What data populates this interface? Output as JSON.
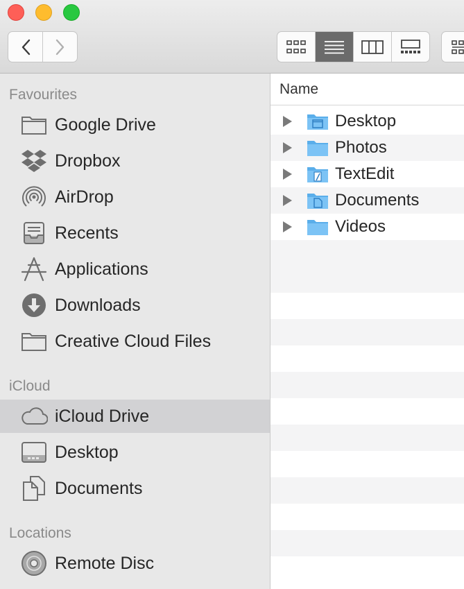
{
  "sidebar": {
    "favourites_title": "Favourites",
    "favourites": [
      {
        "label": "Google Drive",
        "icon": "folder-icon"
      },
      {
        "label": "Dropbox",
        "icon": "dropbox-icon"
      },
      {
        "label": "AirDrop",
        "icon": "airdrop-icon"
      },
      {
        "label": "Recents",
        "icon": "recents-icon"
      },
      {
        "label": "Applications",
        "icon": "applications-icon"
      },
      {
        "label": "Downloads",
        "icon": "downloads-icon"
      },
      {
        "label": "Creative Cloud Files",
        "icon": "folder-icon"
      }
    ],
    "icloud_title": "iCloud",
    "icloud": [
      {
        "label": "iCloud Drive",
        "icon": "icloud-icon",
        "selected": true
      },
      {
        "label": "Desktop",
        "icon": "desktop-icon"
      },
      {
        "label": "Documents",
        "icon": "documents-icon"
      }
    ],
    "locations_title": "Locations",
    "locations": [
      {
        "label": "Remote Disc",
        "icon": "disc-icon"
      }
    ]
  },
  "list": {
    "column_name": "Name",
    "rows": [
      {
        "label": "Desktop",
        "icon": "desktop-folder-icon"
      },
      {
        "label": "Photos",
        "icon": "folder-icon"
      },
      {
        "label": "TextEdit",
        "icon": "textedit-folder-icon"
      },
      {
        "label": "Documents",
        "icon": "documents-folder-icon"
      },
      {
        "label": "Videos",
        "icon": "folder-icon"
      }
    ]
  },
  "toolbar": {
    "active_view": "list",
    "views": [
      "icon",
      "list",
      "column",
      "gallery"
    ]
  },
  "colors": {
    "accent_folder": "#6cb8f0",
    "selected_bg": "#d2d2d4"
  }
}
